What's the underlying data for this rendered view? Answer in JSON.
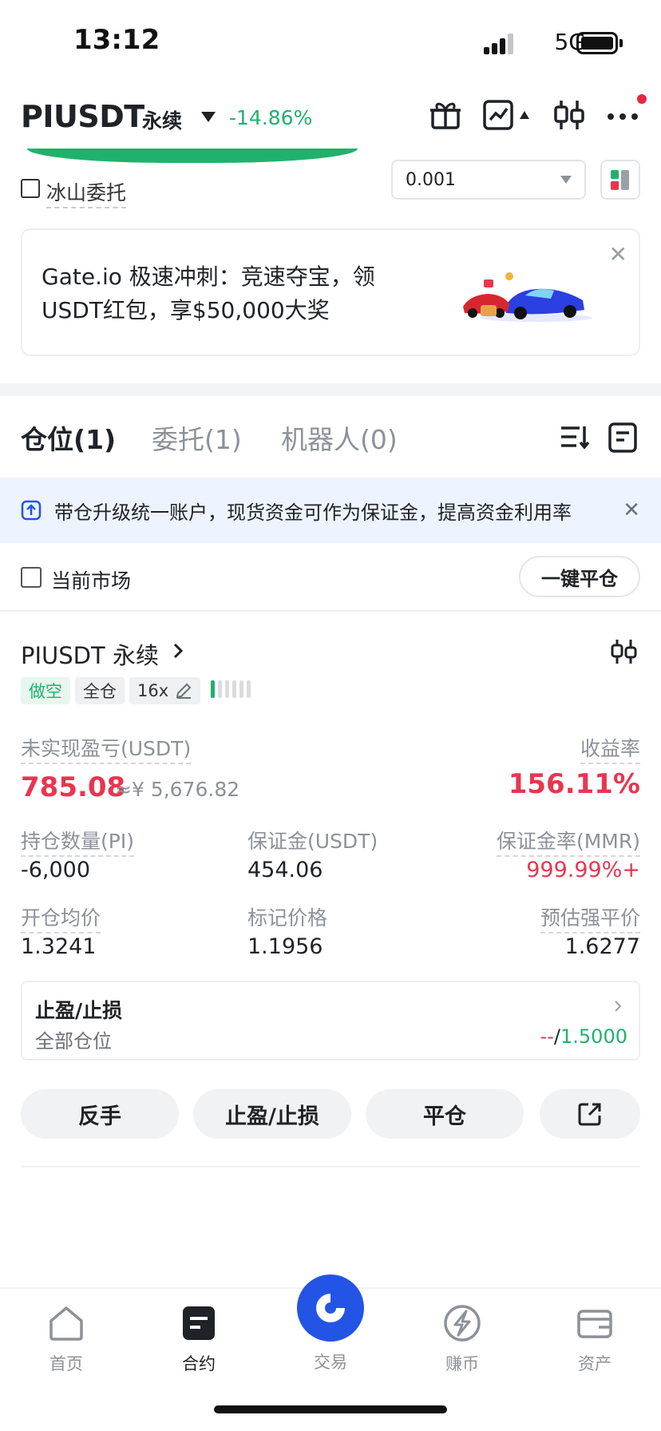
{
  "status_bar": {
    "time": "13:12",
    "network": "5G"
  },
  "header": {
    "pair": "PIUSDT",
    "contract_type": "永续",
    "change": "-14.86%",
    "icons": [
      "gift-icon",
      "chart-trend-icon",
      "candlestick-icon",
      "more-icon"
    ]
  },
  "order_form": {
    "iceberg_label": "冰山委托",
    "precision_value": "0.001"
  },
  "banner": {
    "text": "Gate.io 极速冲刺：竞速夺宝，领USDT红包，享$50,000大奖"
  },
  "tabs": [
    {
      "label": "仓位(1)",
      "active": true
    },
    {
      "label": "委托(1)",
      "active": false
    },
    {
      "label": "机器人(0)",
      "active": false
    }
  ],
  "notice": {
    "text": "带仓升级统一账户，现货资金可作为保证金，提高资金利用率"
  },
  "filter": {
    "current_market_label": "当前市场",
    "close_all_label": "一键平仓"
  },
  "position": {
    "pair": "PIUSDT 永续",
    "side_tag": "做空",
    "margin_mode_tag": "全仓",
    "leverage_tag": "16x",
    "risk_level": 1,
    "unrealized_pnl_label": "未实现盈亏(USDT)",
    "unrealized_pnl": "785.08",
    "unrealized_pnl_cny": "≈¥ 5,676.82",
    "roe_label": "收益率",
    "roe": "156.11%",
    "size_label": "持仓数量(PI)",
    "size": "-6,000",
    "margin_label": "保证金(USDT)",
    "margin": "454.06",
    "mmr_label": "保证金率(MMR)",
    "mmr": "999.99%+",
    "entry_label": "开仓均价",
    "entry": "1.3241",
    "mark_label": "标记价格",
    "mark": "1.1956",
    "liq_label": "预估强平价",
    "liq": "1.6277",
    "tpsl_title": "止盈/止损",
    "tpsl_scope": "全部仓位",
    "tp_value": "--",
    "tpsl_sep": "/",
    "sl_value": "1.5000"
  },
  "actions": {
    "reverse": "反手",
    "tpsl": "止盈/止损",
    "close": "平仓"
  },
  "bottom_nav": [
    {
      "label": "首页",
      "icon": "home-icon",
      "active": false
    },
    {
      "label": "合约",
      "icon": "futures-icon",
      "active": true
    },
    {
      "label": "交易",
      "icon": "trade-icon",
      "active": false
    },
    {
      "label": "赚币",
      "icon": "earn-icon",
      "active": false
    },
    {
      "label": "资产",
      "icon": "wallet-icon",
      "active": false
    }
  ],
  "colors": {
    "green": "#20b26c",
    "red": "#e8364f",
    "blue": "#2354e6"
  }
}
